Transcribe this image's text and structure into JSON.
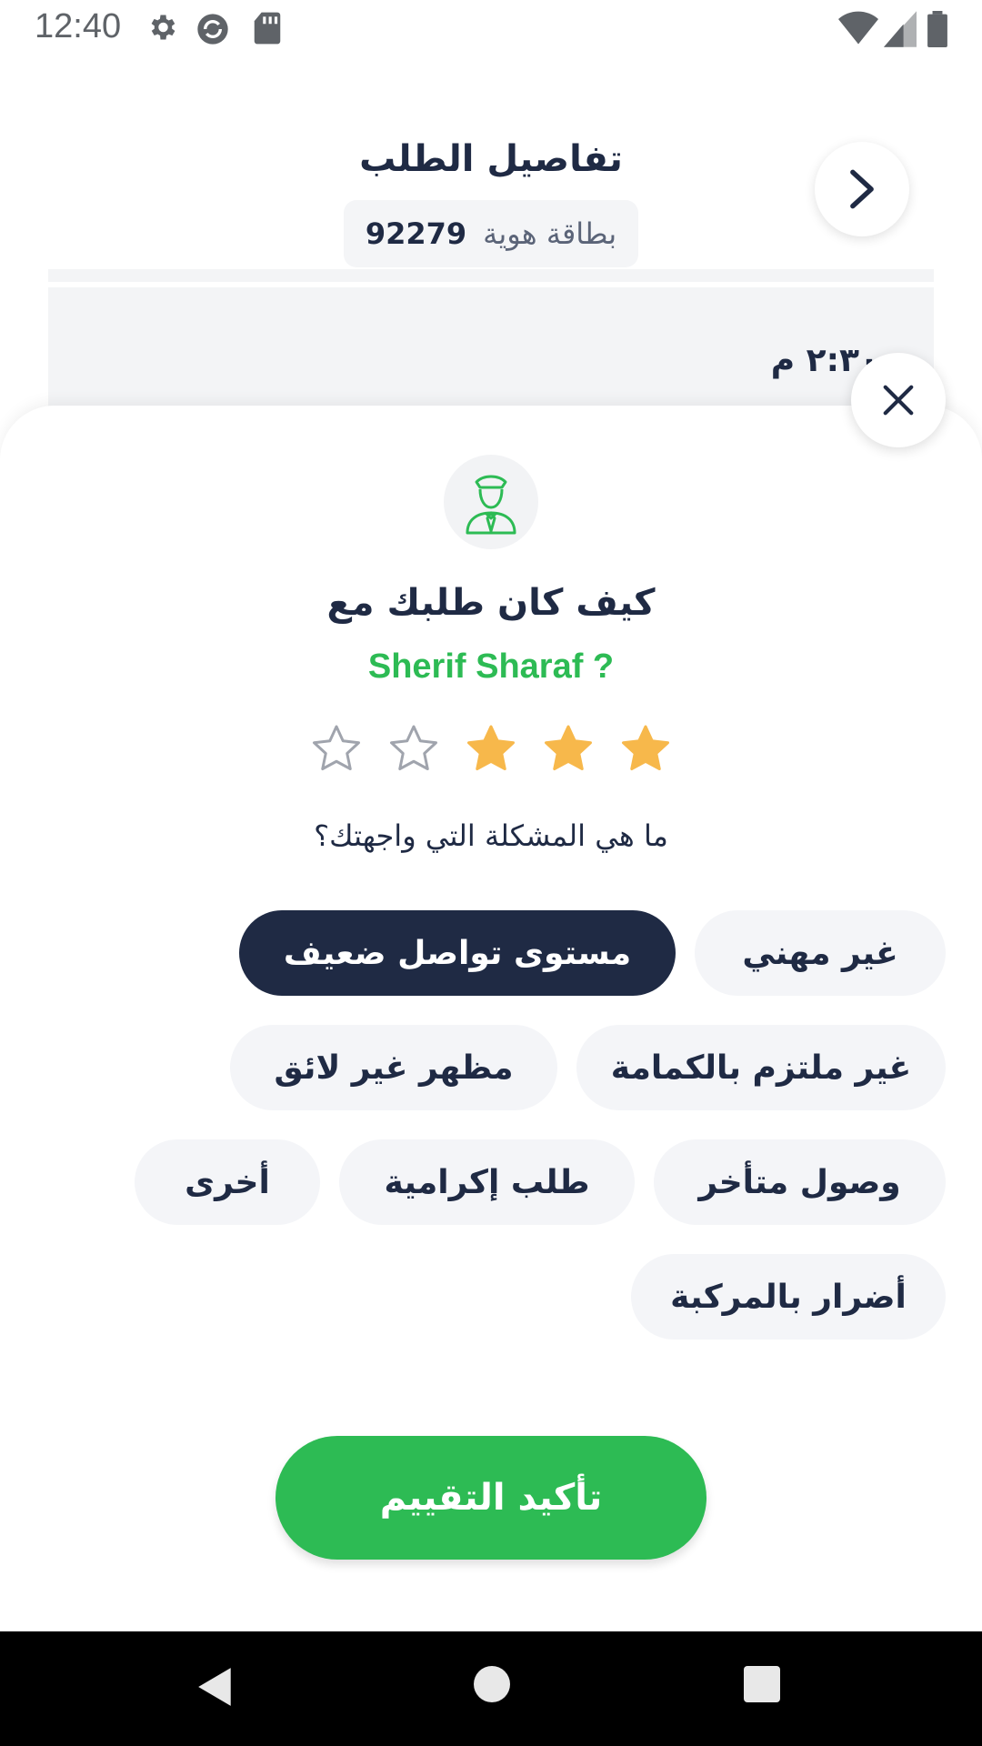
{
  "status_bar": {
    "time": "12:40",
    "icons": [
      "gear-icon",
      "sync-icon",
      "sd-card-icon",
      "wifi-icon",
      "signal-icon",
      "battery-icon"
    ]
  },
  "background_page": {
    "title": "تفاصيل الطلب",
    "id_label": "بطاقة هوية",
    "id_number": "92279",
    "time_partial": "٢:٣٠ م"
  },
  "rating_sheet": {
    "question": "كيف كان طلبك مع",
    "driver_name": "Sherif Sharaf ?",
    "rating": {
      "value": 3,
      "max": 5
    },
    "problem_question": "ما هي المشكلة التي واجهتك؟",
    "issues": [
      {
        "label": "غير مهني",
        "selected": false
      },
      {
        "label": "مستوى تواصل ضعيف",
        "selected": true
      },
      {
        "label": "غير ملتزم بالكمامة",
        "selected": false
      },
      {
        "label": "مظهر غير لائق",
        "selected": false
      },
      {
        "label": "وصول متأخر",
        "selected": false
      },
      {
        "label": "طلب إكرامية",
        "selected": false
      },
      {
        "label": "أخرى",
        "selected": false
      },
      {
        "label": "أضرار بالمركبة",
        "selected": false
      }
    ],
    "confirm_label": "تأكيد التقييم"
  },
  "colors": {
    "accent_green": "#2dbb54",
    "navy": "#1f2a44",
    "star_filled": "#f7b84b",
    "chip_bg": "#f4f5f8"
  }
}
